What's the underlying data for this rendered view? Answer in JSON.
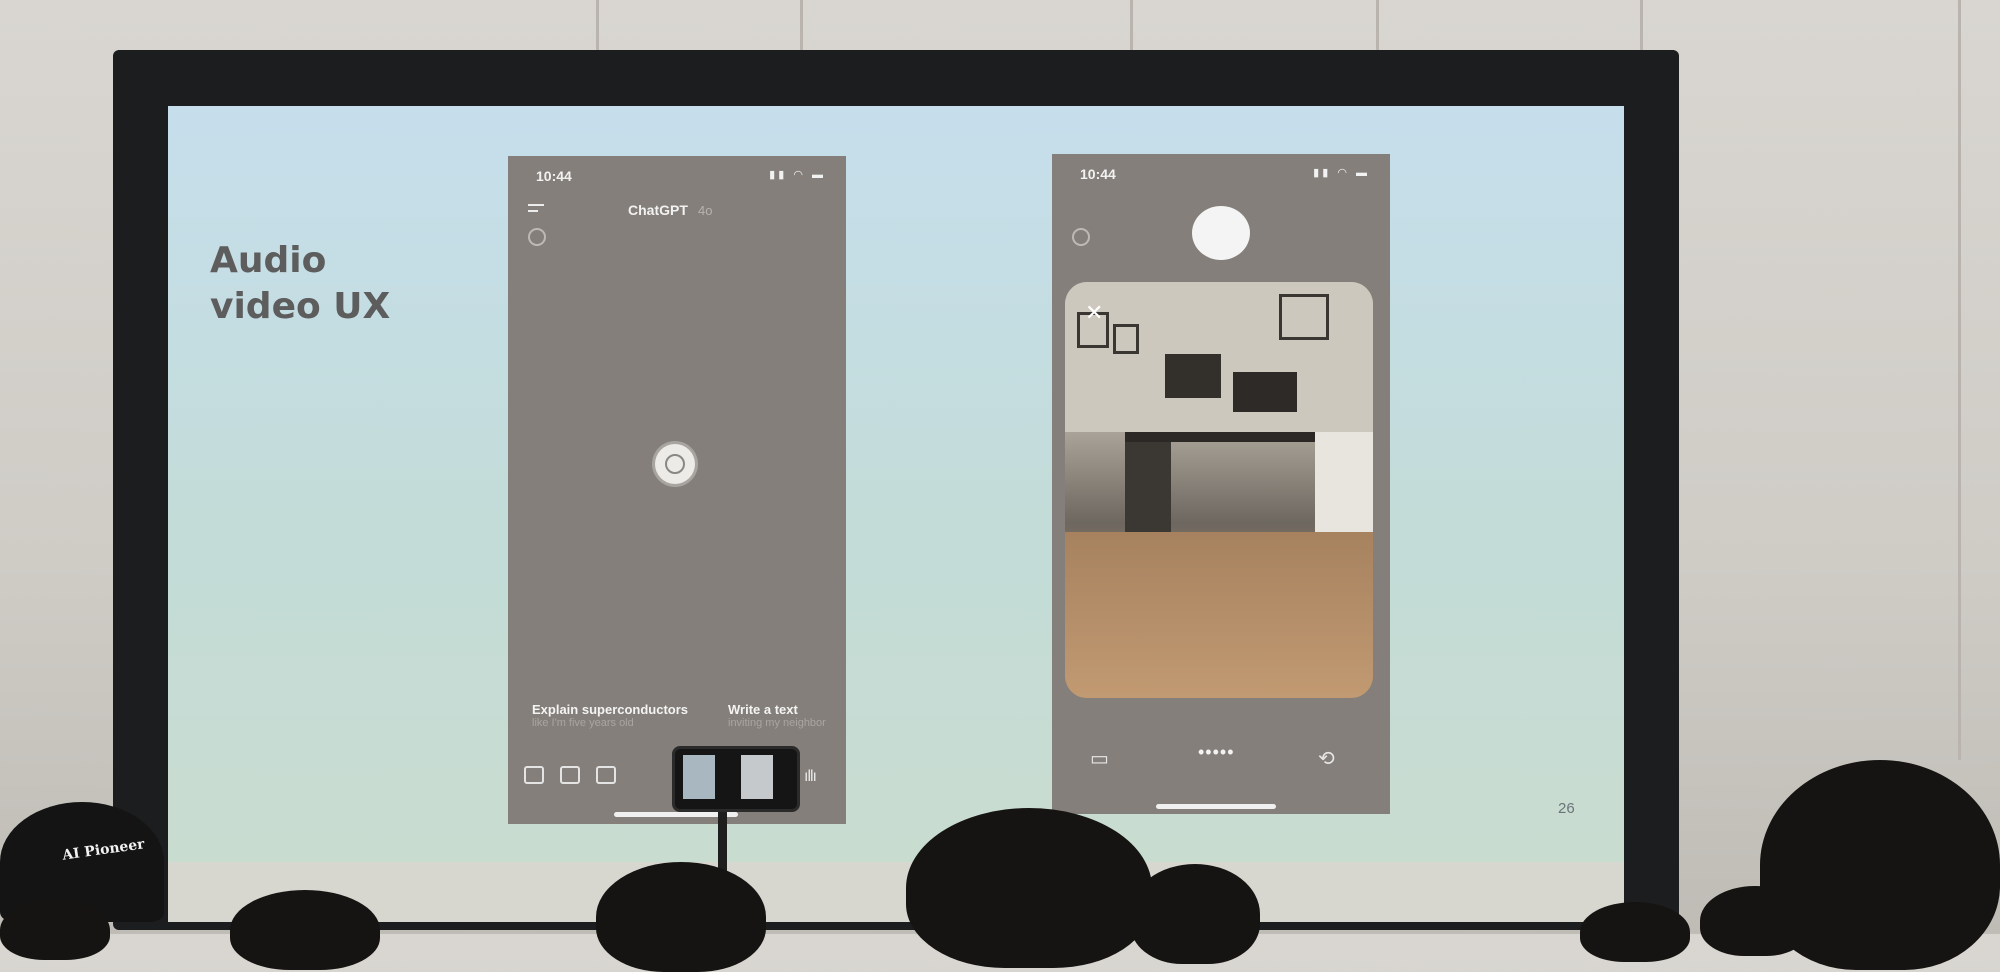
{
  "slide": {
    "title_line1": "Audio",
    "title_line2": "video UX",
    "page_number": "26"
  },
  "left_phone": {
    "status_time": "10:44",
    "app_title": "ChatGPT",
    "model_label": "4o",
    "suggestions": [
      {
        "title": "Explain superconductors",
        "subtitle": "like I'm five years old"
      },
      {
        "title": "Write a text",
        "subtitle": "inviting my neighbor"
      }
    ],
    "icons": [
      "menu-icon",
      "camera-icon",
      "image-icon",
      "folder-icon",
      "voice-wave-icon"
    ]
  },
  "right_phone": {
    "status_time": "10:44",
    "icons": [
      "close-icon",
      "screen-share-icon",
      "more-dots-icon",
      "switch-camera-icon"
    ]
  },
  "audience_cap_text": "AI Pioneer"
}
